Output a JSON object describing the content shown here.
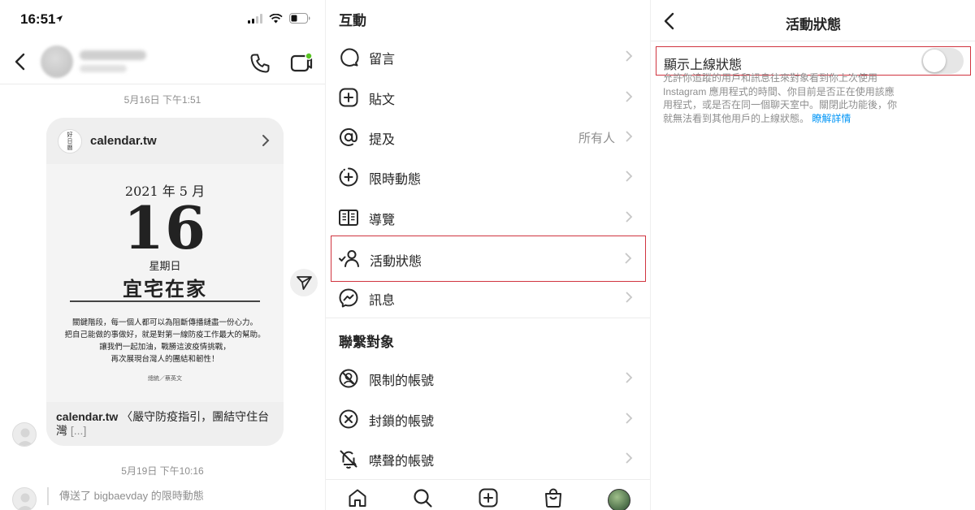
{
  "colors": {
    "link": "#0095f6",
    "highlight": "#d0343f",
    "muted": "#8e8e8e",
    "online_dot": "#58c322"
  },
  "chat": {
    "status_time": "16:51",
    "date1": "5月16日 下午1:51",
    "card": {
      "site": "calendar.tw",
      "logo_text": "好日曆",
      "cal_month": "2021 年 5 月",
      "cal_day": "16",
      "cal_weekday": "星期日",
      "cal_motto": "宜宅在家",
      "cal_lines": [
        "關鍵階段，每一個人都可以為阻斷傳播鏈盡一份心力。",
        "把自己能做的事做好，就是對第一線防疫工作最大的幫助。",
        "讓我們一起加油，戰勝這波疫情挑戰，",
        "再次展現台灣人的團結和韌性！"
      ],
      "cal_sign": "總統／蔡英文",
      "footer_bold": "calendar.tw",
      "footer_text": " 〈嚴守防疫指引，團結守住台灣",
      "footer_more": " [...]"
    },
    "date2": "5月19日 下午10:16",
    "story_reply": "傳送了 bigbaevday 的限時動態"
  },
  "settings": {
    "section_interactions": "互動",
    "interactions": [
      {
        "label": "留言",
        "icon": "comment-icon"
      },
      {
        "label": "貼文",
        "icon": "add-post-icon"
      },
      {
        "label": "提及",
        "icon": "mention-icon",
        "value": "所有人"
      },
      {
        "label": "限時動態",
        "icon": "story-icon"
      },
      {
        "label": "導覽",
        "icon": "guide-icon"
      },
      {
        "label": "活動狀態",
        "icon": "activity-status-icon",
        "highlighted": true
      },
      {
        "label": "訊息",
        "icon": "messenger-icon"
      }
    ],
    "section_connections": "聯繫對象",
    "connections": [
      {
        "label": "限制的帳號",
        "icon": "restricted-icon"
      },
      {
        "label": "封鎖的帳號",
        "icon": "blocked-icon"
      },
      {
        "label": "噤聲的帳號",
        "icon": "muted-icon"
      }
    ],
    "tabs": [
      "home-icon",
      "search-icon",
      "create-icon",
      "shop-icon",
      "profile-avatar"
    ]
  },
  "activity": {
    "title": "活動狀態",
    "toggle_label": "顯示上線狀態",
    "toggle_on": false,
    "desc_line1": "允許你追蹤的用戶和訊息往來對象看到你上次使用",
    "desc_line2": "Instagram 應用程式的時間、你目前是否正在使用該應",
    "desc_line3": "用程式，或是否在同一個聊天室中。關閉此功能後，你",
    "desc_line4": "就無法看到其他用戶的上線狀態。",
    "learn_more": "瞭解詳情"
  }
}
